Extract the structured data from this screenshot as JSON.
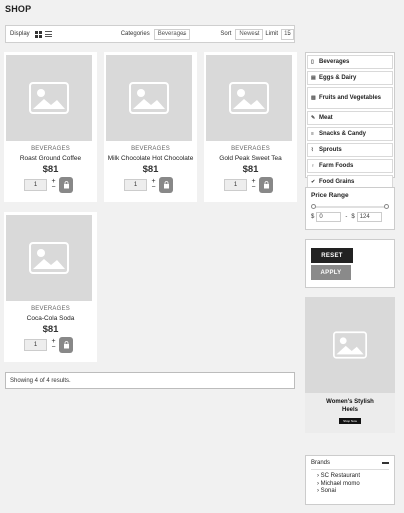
{
  "page": {
    "title": "SHOP"
  },
  "toolbar": {
    "display_label": "Display",
    "categories_label": "Categories",
    "categories_value": "Beverages",
    "sort_label": "Sort",
    "sort_value": "Newest",
    "limit_label": "Limit",
    "limit_value": "15"
  },
  "products": [
    {
      "category": "BEVERAGES",
      "name": "Roast Ground Coffee",
      "price": "$81",
      "qty": "1"
    },
    {
      "category": "BEVERAGES",
      "name": "Milk Chocolate Hot Chocolate",
      "price": "$81",
      "qty": "1"
    },
    {
      "category": "BEVERAGES",
      "name": "Gold Peak Sweet Tea",
      "price": "$81",
      "qty": "1"
    },
    {
      "category": "BEVERAGES",
      "name": "Coca-Cola Soda",
      "price": "$81",
      "qty": "1"
    }
  ],
  "results_text": "Showing 4 of 4  results.",
  "sidebar": {
    "categories": [
      {
        "label": "Beverages",
        "icon": "bottle-icon"
      },
      {
        "label": "Eggs & Dairy",
        "icon": "egg-icon"
      },
      {
        "label": "Fruits and Vegetables",
        "icon": "fruit-icon"
      },
      {
        "label": "Meat",
        "icon": "meat-icon"
      },
      {
        "label": "Snacks & Candy",
        "icon": "snack-icon"
      },
      {
        "label": "Sprouts",
        "icon": "sprout-icon"
      },
      {
        "label": "Farm Foods",
        "icon": "farm-icon"
      },
      {
        "label": "Food Grains",
        "icon": "grain-icon"
      }
    ],
    "price_range": {
      "title": "Price Range",
      "currency": "$",
      "min": "0",
      "max": "124",
      "separator": "-"
    },
    "reset_label": "RESET",
    "apply_label": "APPLY",
    "ad": {
      "line1": "Women's Stylish",
      "line2": "Heels",
      "button": "Shop Now"
    },
    "brands": {
      "title": "Brands",
      "items": [
        "SC Restaurant",
        "Michael momo",
        "Sonai"
      ]
    }
  }
}
